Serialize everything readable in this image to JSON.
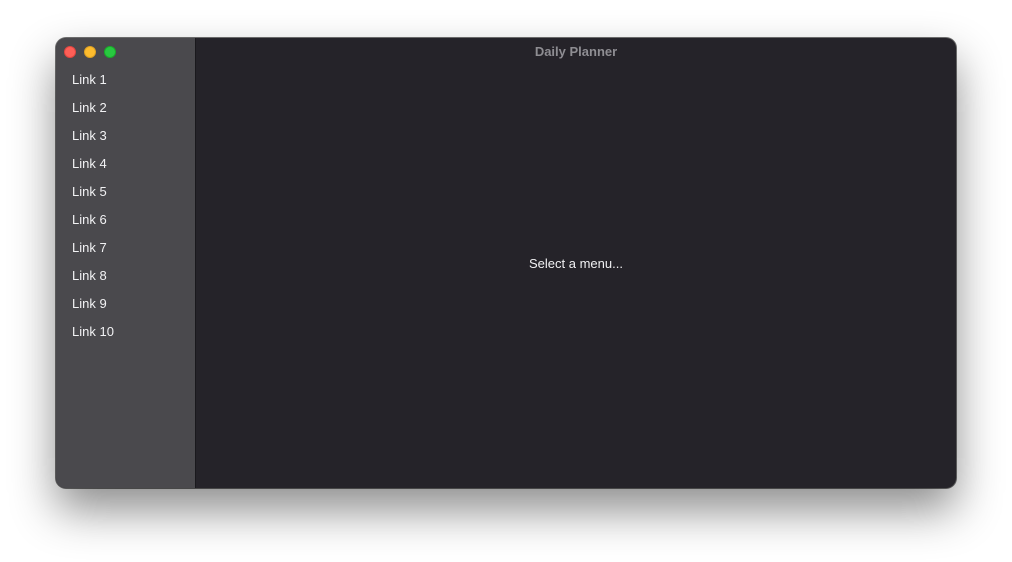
{
  "window": {
    "title": "Daily Planner",
    "controls": [
      "close-button",
      "minimize-button",
      "zoom-button"
    ]
  },
  "sidebar": {
    "items": [
      {
        "label": "Link 1"
      },
      {
        "label": "Link 2"
      },
      {
        "label": "Link 3"
      },
      {
        "label": "Link 4"
      },
      {
        "label": "Link 5"
      },
      {
        "label": "Link 6"
      },
      {
        "label": "Link 7"
      },
      {
        "label": "Link 8"
      },
      {
        "label": "Link 9"
      },
      {
        "label": "Link 10"
      }
    ]
  },
  "main": {
    "placeholder": "Select a menu..."
  },
  "colors": {
    "sidebar_bg": "#4a494d",
    "content_bg": "#252329",
    "close": "#fe5f57",
    "minimize": "#febc2e",
    "zoom": "#28c840"
  }
}
